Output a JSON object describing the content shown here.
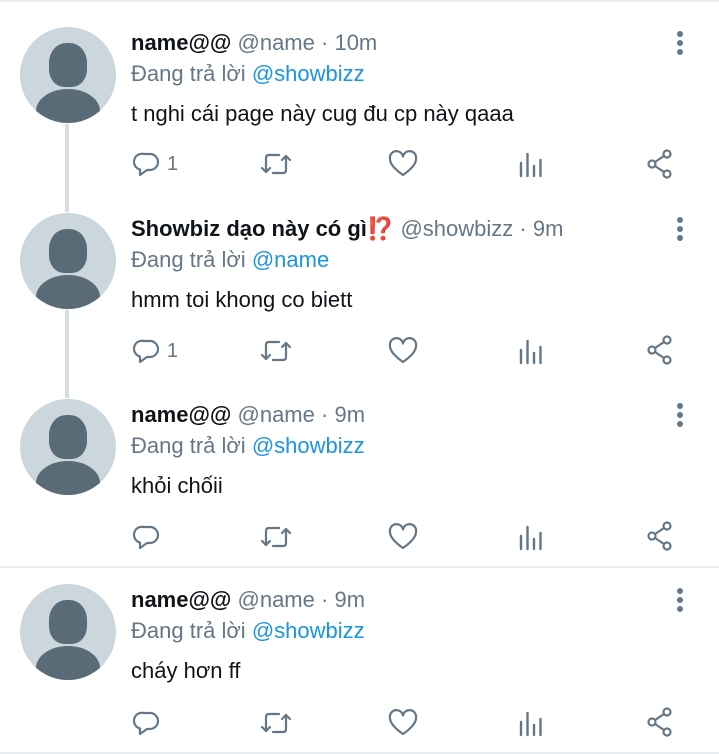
{
  "tweets": [
    {
      "name": "name@@",
      "handle": "@name",
      "separator": "·",
      "time": "10m",
      "reply_prefix": "Đang trả lời",
      "reply_to": "@showbizz",
      "text": "t nghi cái page này cug đu cp này qaaa",
      "reply_count": "1"
    },
    {
      "name": "Showbiz dạo này có gì",
      "emoji": "⁉️",
      "handle": "@showbizz",
      "separator": "·",
      "time": "9m",
      "reply_prefix": "Đang trả lời",
      "reply_to": "@name",
      "text": "hmm toi khong co biett",
      "reply_count": "1"
    },
    {
      "name": "name@@",
      "handle": "@name",
      "separator": "·",
      "time": "9m",
      "reply_prefix": "Đang trả lời",
      "reply_to": "@showbizz",
      "text": "khỏi chốii",
      "reply_count": ""
    },
    {
      "name": "name@@",
      "handle": "@name",
      "separator": "·",
      "time": "9m",
      "reply_prefix": "Đang trả lời",
      "reply_to": "@showbizz",
      "text": "cháy hơn ff",
      "reply_count": ""
    }
  ],
  "icons": {
    "reply": "reply-icon",
    "retweet": "retweet-icon",
    "like": "like-icon",
    "views": "views-icon",
    "share": "share-icon",
    "more": "more-icon"
  },
  "colors": {
    "secondary_text": "#657786",
    "mention": "#1b95e0",
    "avatar_bg": "#ccd6dd",
    "avatar_fg": "#5a6b78",
    "thread_line": "#d4dde3"
  }
}
